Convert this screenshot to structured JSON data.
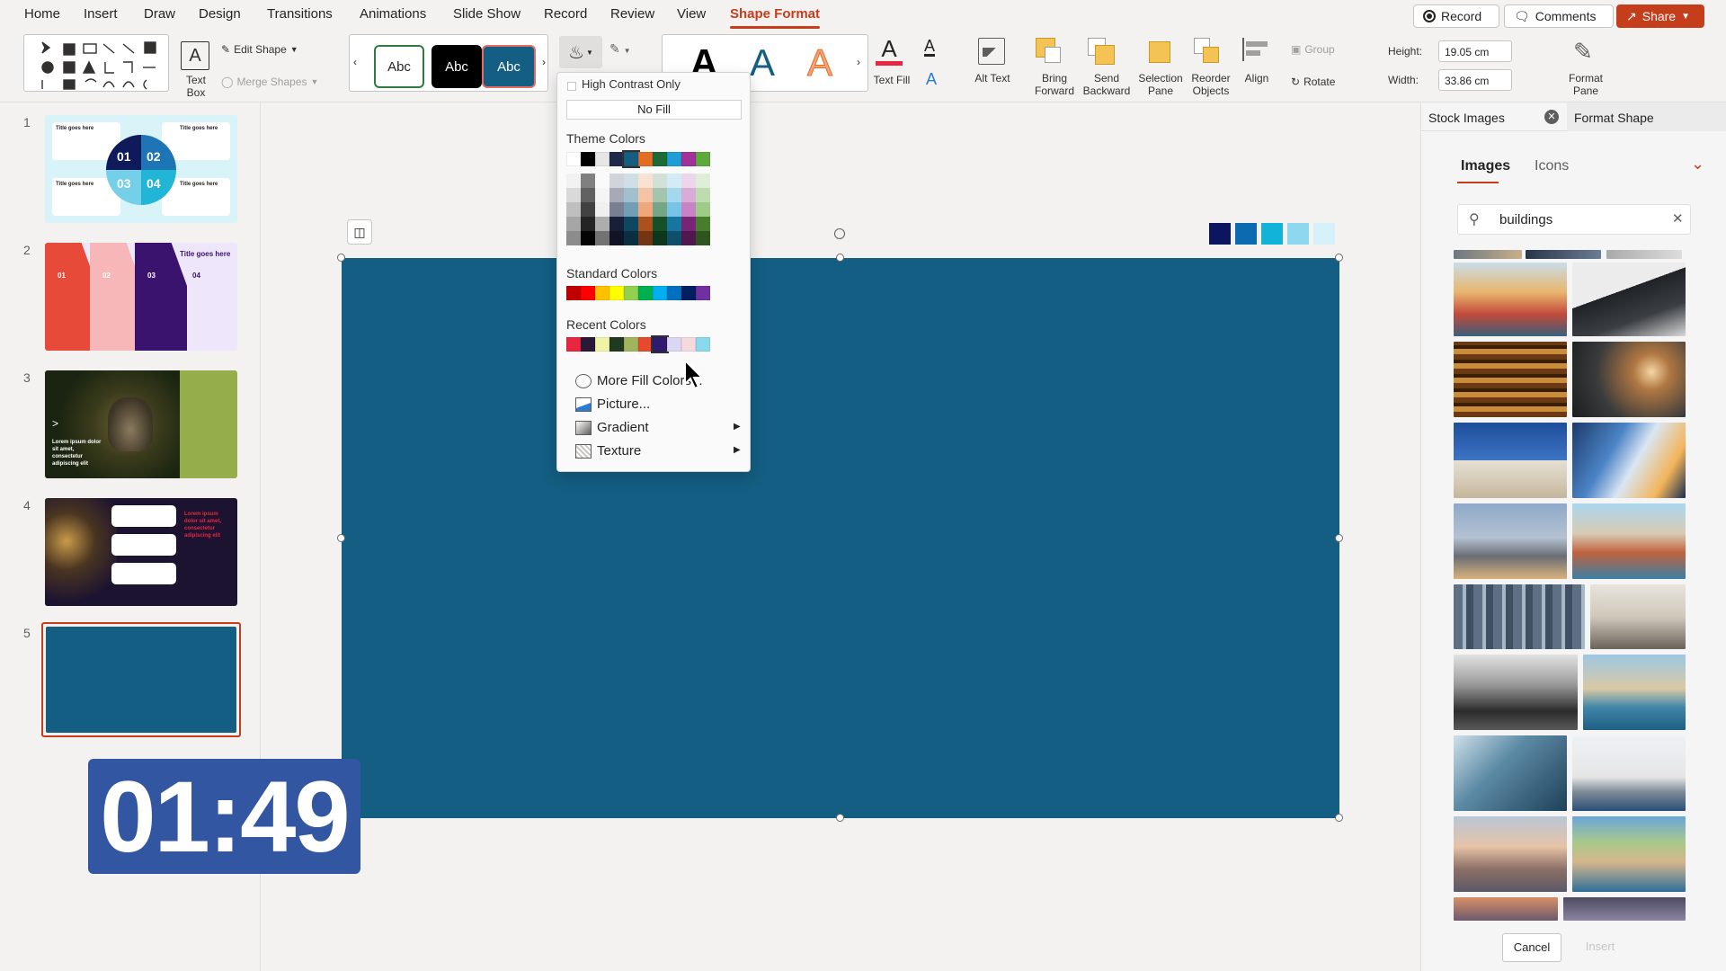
{
  "tabs": [
    {
      "label": "Home"
    },
    {
      "label": "Insert"
    },
    {
      "label": "Draw"
    },
    {
      "label": "Design"
    },
    {
      "label": "Transitions"
    },
    {
      "label": "Animations"
    },
    {
      "label": "Slide Show"
    },
    {
      "label": "Record"
    },
    {
      "label": "Review"
    },
    {
      "label": "View"
    },
    {
      "label": "Shape Format"
    }
  ],
  "top_buttons": {
    "record": "Record",
    "comments": "Comments",
    "share": "Share"
  },
  "ribbon": {
    "text_box": "Text Box",
    "edit_shape": "Edit Shape",
    "merge_shapes": "Merge Shapes",
    "abc": "Abc",
    "text_fill": "Text Fill",
    "alt_text": "Alt Text",
    "bring_forward": "Bring Forward",
    "send_backward": "Send Backward",
    "selection_pane": "Selection Pane",
    "reorder_objects": "Reorder Objects",
    "align": "Align",
    "group": "Group",
    "rotate": "Rotate",
    "height_label": "Height:",
    "height_value": "19.05 cm",
    "width_label": "Width:",
    "width_value": "33.86 cm",
    "format_pane": "Format Pane"
  },
  "slides": [
    {
      "n": "1"
    },
    {
      "n": "2"
    },
    {
      "n": "3"
    },
    {
      "n": "4"
    },
    {
      "n": "5"
    }
  ],
  "thumb_text": {
    "title_goes_here": "Title goes here",
    "n01": "01",
    "n02": "02",
    "n03": "03",
    "n04": "04",
    "lorem": "Lorem ipsum dolor sit amet, consectetur adipiscing elit"
  },
  "timer": "01:49",
  "fill_menu": {
    "high_contrast": "High Contrast Only",
    "no_fill": "No Fill",
    "theme_colors": "Theme Colors",
    "standard_colors": "Standard Colors",
    "recent_colors": "Recent Colors",
    "more_fill_colors": "More Fill Colors...",
    "picture": "Picture...",
    "gradient": "Gradient",
    "texture": "Texture",
    "theme_row": [
      "#ffffff",
      "#000000",
      "#e7e6e6",
      "#1e2a4a",
      "#135e82",
      "#e46c24",
      "#1c6b35",
      "#1e9dd6",
      "#a1309b",
      "#5fa83a"
    ],
    "standard_row": [
      "#c00000",
      "#ff0000",
      "#ffc000",
      "#ffff00",
      "#92d050",
      "#00b050",
      "#00b0f0",
      "#0070c0",
      "#002060",
      "#7030a0"
    ],
    "recent_row": [
      "#e8263f",
      "#2b1838",
      "#f0f3a5",
      "#1f3a20",
      "#a0b45d",
      "#e8492e",
      "#2f1a6e",
      "#dcd6f2",
      "#f6d9dd",
      "#8bd9ec"
    ]
  },
  "slide_palette": [
    "#0b1560",
    "#0b6ab0",
    "#12b3d9",
    "#8fd7ef",
    "#d6f1fa"
  ],
  "stock": {
    "stock_images": "Stock Images",
    "format_shape": "Format Shape",
    "images": "Images",
    "icons": "Icons",
    "search_value": "buildings",
    "cancel": "Cancel",
    "insert": "Insert"
  }
}
